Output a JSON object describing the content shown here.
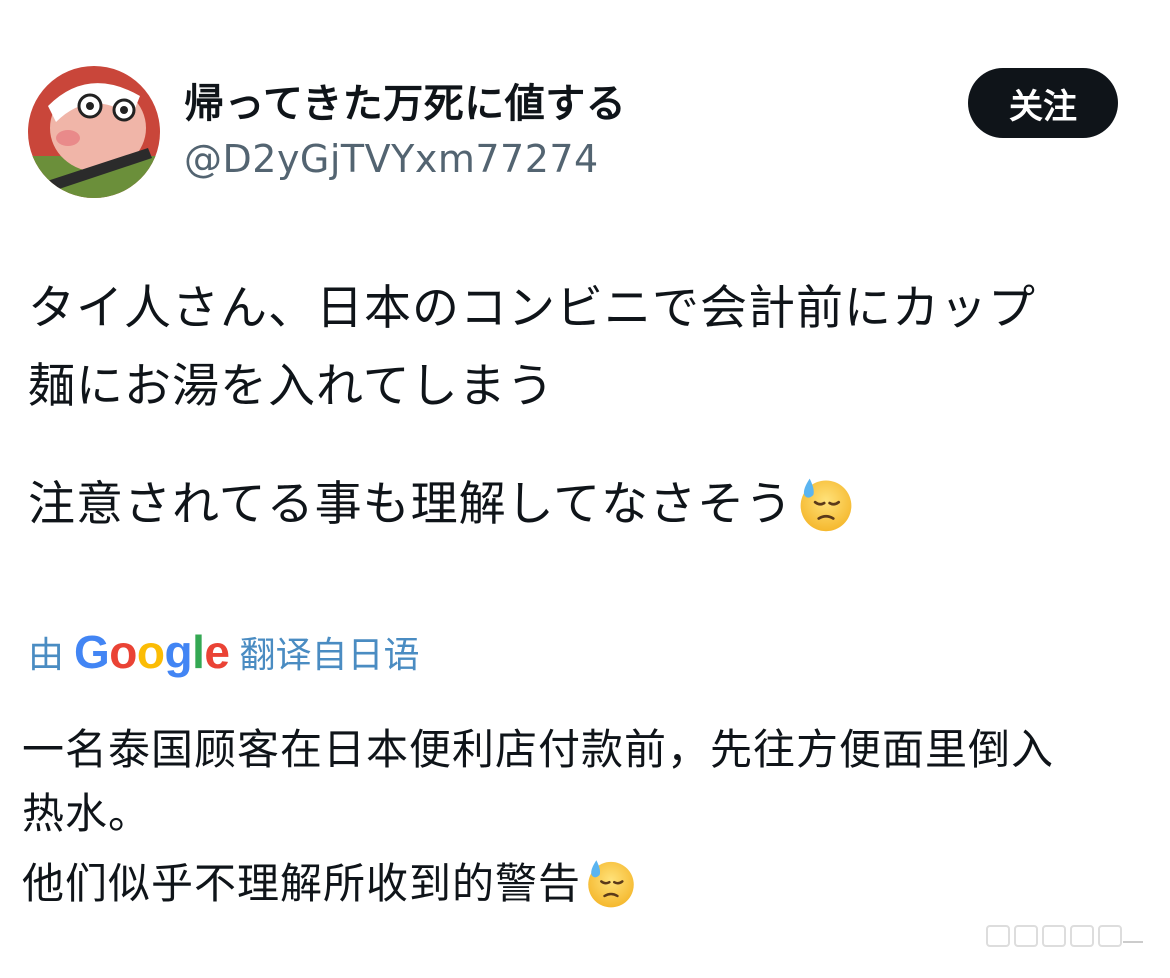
{
  "author": {
    "display_name": "帰ってきた万死に値する",
    "handle": "@D2yGjTVYxm77274"
  },
  "follow_button": {
    "label": "关注"
  },
  "tweet": {
    "lines": [
      "タイ人さん、日本のコンビニで会計前にカップ",
      "麺にお湯を入れてしまう"
    ],
    "line3": "注意されてる事も理解してなさそう",
    "emoji": "downcast-face-with-sweat"
  },
  "translation_bar": {
    "prefix": "由",
    "brand": "Google",
    "suffix": "翻译自日语",
    "color": "#4a8cc2"
  },
  "translated": {
    "lines": [
      "一名泰国顾客在日本便利店付款前，先往方便面里倒入",
      "热水。"
    ],
    "line3": "他们似乎不理解所收到的警告",
    "emoji": "downcast-face-with-sweat"
  },
  "colors": {
    "text": "#0f1419",
    "secondary": "#536471",
    "button_bg": "#0f1419",
    "button_text": "#ffffff"
  }
}
